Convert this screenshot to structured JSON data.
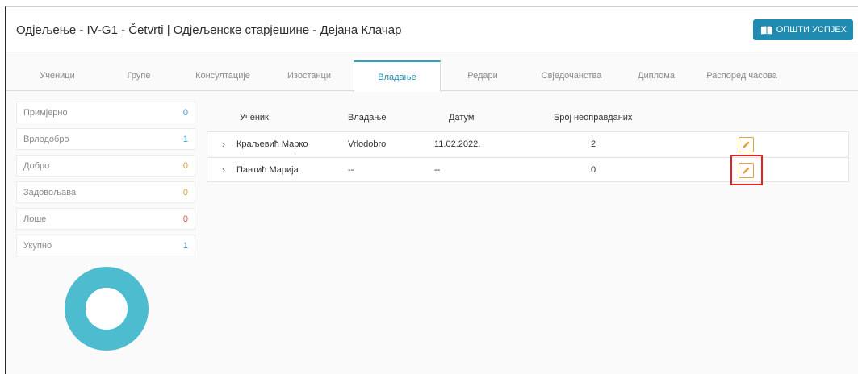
{
  "header": {
    "title": "Одјељење - IV-G1 - Četvrti | Одјељенске старјешине - Дејана Клачар",
    "success_button": "ОПШТИ УСПЈЕХ"
  },
  "tabs": [
    {
      "label": "Ученици"
    },
    {
      "label": "Групе"
    },
    {
      "label": "Консултације"
    },
    {
      "label": "Изостанци"
    },
    {
      "label": "Владање",
      "active": true
    },
    {
      "label": "Редари"
    },
    {
      "label": "Свједочанства"
    },
    {
      "label": "Диплома"
    },
    {
      "label": "Распоред часова"
    }
  ],
  "stats": [
    {
      "label": "Примјерно",
      "value": "0",
      "color": "#3a8fc7"
    },
    {
      "label": "Врлодобро",
      "value": "1",
      "color": "#3aa8c7"
    },
    {
      "label": "Добро",
      "value": "0",
      "color": "#e0a33c"
    },
    {
      "label": "Задовољава",
      "value": "0",
      "color": "#e0a33c"
    },
    {
      "label": "Лоше",
      "value": "0",
      "color": "#e05a4a"
    },
    {
      "label": "Укупно",
      "value": "1",
      "color": "#3a8fc7"
    }
  ],
  "donut_color": "#4dbccf",
  "table": {
    "columns": [
      "Ученик",
      "Владање",
      "Датум",
      "Број неоправданих"
    ],
    "rows": [
      {
        "student": "Краљевић Марко",
        "conduct": "Vrlodobro",
        "date": "11.02.2022.",
        "unexcused": "2"
      },
      {
        "student": "Пантић Марија",
        "conduct": "--",
        "date": "--",
        "unexcused": "0"
      }
    ]
  },
  "icons": {
    "success_button": "book-icon",
    "row_toggle": "chevron-right-icon",
    "row_action": "pencil-icon"
  }
}
